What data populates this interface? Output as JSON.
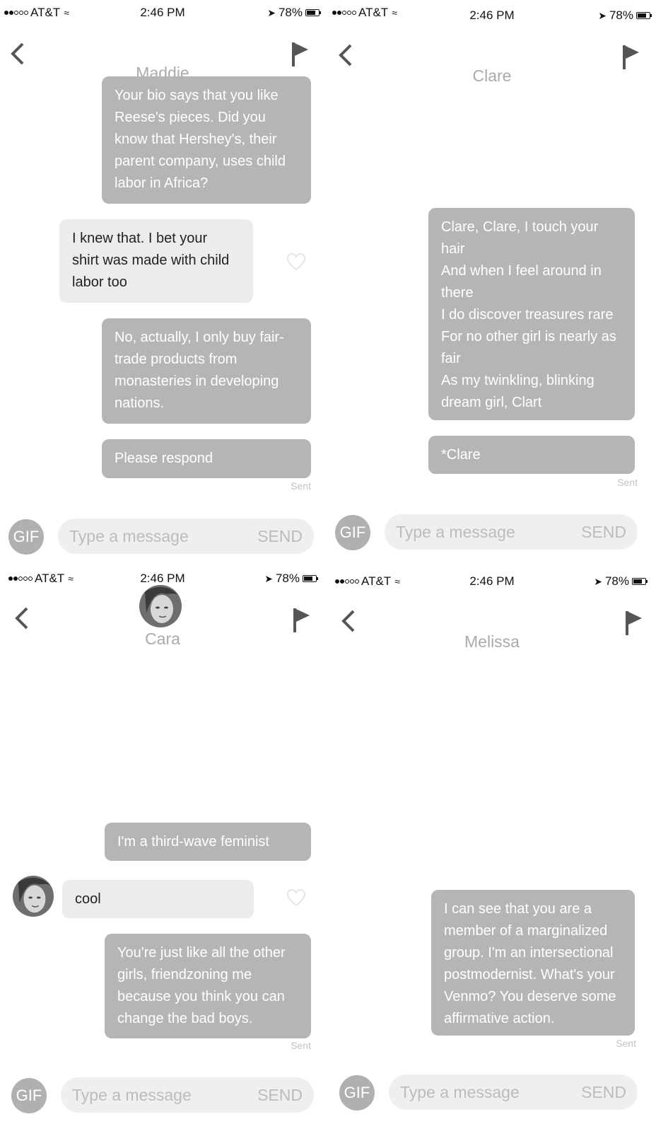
{
  "status_bar": {
    "carrier": "AT&T",
    "time": "2:46 PM",
    "battery": "78%",
    "battery_level": 0.78
  },
  "panels": [
    {
      "contact_name": "Maddie",
      "messages": [
        {
          "direction": "outgoing",
          "text": "Your bio says that you like\nReese's pieces. Did you\nknow that Hershey's, their\nparent company, uses child\nlabor in Africa?"
        },
        {
          "direction": "incoming",
          "text": "I knew that. I bet your\nshirt was made with child\nlabor too"
        },
        {
          "direction": "outgoing",
          "text": "No, actually, I only buy fair-\ntrade products from\nmonasteries in developing\nnations."
        },
        {
          "direction": "outgoing",
          "text": "Please respond"
        }
      ],
      "sent_label": "Sent",
      "composer": {
        "gif_label": "GIF",
        "placeholder": "Type a message",
        "send_label": "SEND"
      }
    },
    {
      "contact_name": "Clare",
      "messages": [
        {
          "direction": "outgoing",
          "text": "Clare, Clare, I touch your\nhair\nAnd when I feel around in\nthere\nI do discover treasures rare\nFor no other girl is nearly as\nfair\nAs my twinkling, blinking\ndream girl, Clart"
        },
        {
          "direction": "outgoing",
          "text": "*Clare"
        }
      ],
      "sent_label": "Sent",
      "composer": {
        "gif_label": "GIF",
        "placeholder": "Type a message",
        "send_label": "SEND"
      }
    },
    {
      "contact_name": "Cara",
      "messages": [
        {
          "direction": "outgoing",
          "text": "I'm a third-wave feminist"
        },
        {
          "direction": "incoming",
          "text": "cool"
        },
        {
          "direction": "outgoing",
          "text": "You're just like all the other\ngirls, friendzoning me\nbecause you think you can\nchange the bad boys."
        }
      ],
      "sent_label": "Sent",
      "composer": {
        "gif_label": "GIF",
        "placeholder": "Type a message",
        "send_label": "SEND"
      }
    },
    {
      "contact_name": "Melissa",
      "messages": [
        {
          "direction": "outgoing",
          "text": "I can see that you are a\nmember of a marginalized\ngroup. I'm an intersectional\npostmodernist. What's your\nVenmo? You deserve some\naffirmative action."
        }
      ],
      "sent_label": "Sent",
      "composer": {
        "gif_label": "GIF",
        "placeholder": "Type a message",
        "send_label": "SEND"
      }
    }
  ]
}
